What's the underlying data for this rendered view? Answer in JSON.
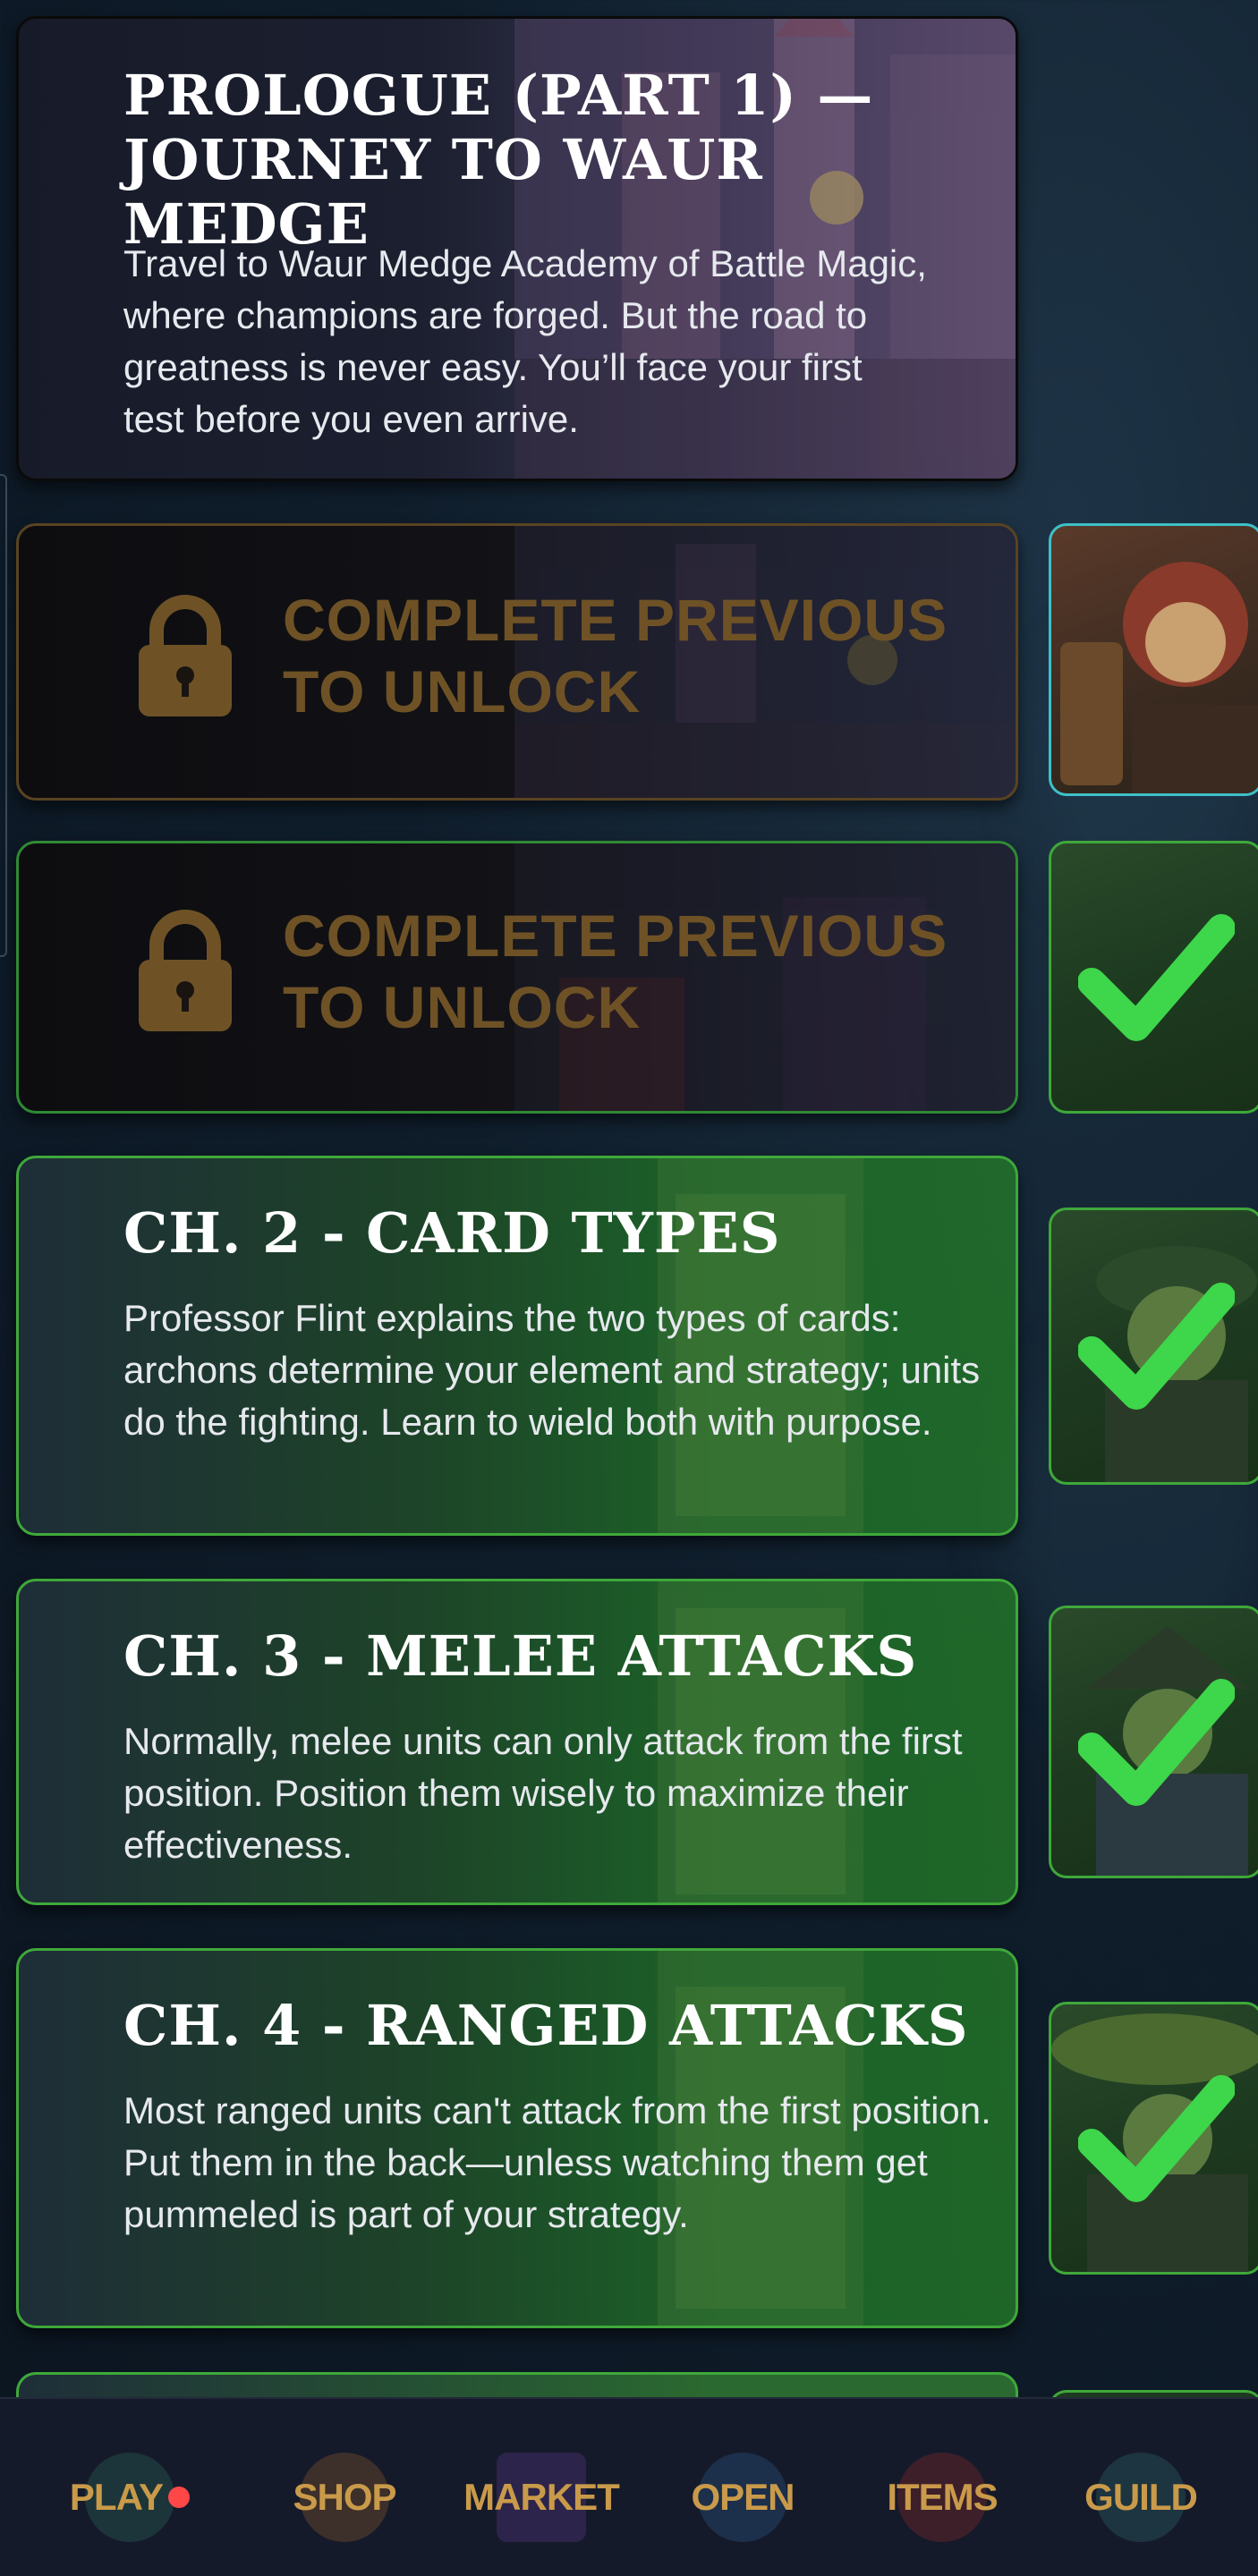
{
  "chapters": [
    {
      "title_line1": "PROLOGUE (PART 1) —",
      "title_line2": "JOURNEY TO WAUR MEDGE",
      "description": "Travel to Waur Medge Academy of Battle Magic, where champions are forged. But the road to greatness is never easy. You’ll face your first test before you even arrive."
    },
    {
      "locked_line1": "COMPLETE PREVIOUS",
      "locked_line2": "TO UNLOCK"
    },
    {
      "locked_line1": "COMPLETE PREVIOUS",
      "locked_line2": "TO UNLOCK"
    },
    {
      "title": "CH. 2 - CARD TYPES",
      "description": "Professor Flint explains the two types of cards: archons determine your element and strategy; units do the fighting. Learn to wield both with purpose."
    },
    {
      "title": "CH. 3 - MELEE ATTACKS",
      "description": "Normally, melee units can only attack from the first position. Position them wisely to maximize their effectiveness."
    },
    {
      "title": "CH. 4 - RANGED ATTACKS",
      "description": "Most ranged units can't attack from the first position. Put them in the back—unless watching them get pummeled is part of your strategy."
    }
  ],
  "nav": {
    "play": "PLAY",
    "shop": "SHOP",
    "market": "MARKET",
    "open": "OPEN",
    "items": "ITEMS",
    "guild": "GUILD"
  },
  "icons": {
    "lock": "lock-icon",
    "check": "checkmark-icon"
  },
  "colors": {
    "accent_green": "#3fa83a",
    "check_green": "#3ed64a",
    "locked_text": "#6e5226",
    "nav_label": "#c99a4a",
    "notification_dot": "#ff4747",
    "active_thumb_border": "#3fc0c8"
  }
}
